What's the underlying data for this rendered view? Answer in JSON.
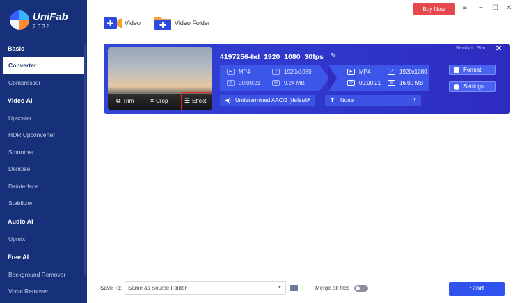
{
  "app": {
    "name": "UniFab",
    "version": "2.0.3.8"
  },
  "topbar": {
    "buy_now": "Buy Now",
    "menu_icon": "≡",
    "minimize_icon": "−",
    "maximize_icon": "☐",
    "close_icon": "✕"
  },
  "sidebar": {
    "sections": [
      {
        "title": "Basic",
        "items": [
          "Converter",
          "Compressor"
        ]
      },
      {
        "title": "Video AI",
        "items": [
          "Upscaler",
          "HDR Upconverter",
          "Smoother",
          "Denoise",
          "Deinterlace",
          "Stabilizer"
        ]
      },
      {
        "title": "Audio AI",
        "items": [
          "Upmix"
        ]
      },
      {
        "title": "Free AI",
        "items": [
          "Background Remover",
          "Vocal Remover"
        ]
      }
    ],
    "active": "Converter"
  },
  "toolbar": {
    "add_video": "Video",
    "add_folder": "Video Folder"
  },
  "task": {
    "status": "Ready to Start",
    "filename": "4197256-hd_1920_1080_30fps",
    "tools": {
      "trim": "Trim",
      "crop": "Crop",
      "effect": "Effect"
    },
    "source": {
      "format": "MP4",
      "resolution": "1920x1080",
      "duration": "00:00:21",
      "size": "9.24 MB"
    },
    "output": {
      "format": "MP4",
      "resolution": "1920x1080",
      "duration": "00:00:21",
      "size": "16.00 MB"
    },
    "audio_track": "Undetermined AAC/2 (default",
    "subtitle": "None",
    "format_button": "Format",
    "settings_button": "Settings"
  },
  "bottom": {
    "save_to_label": "Save To:",
    "save_to_value": "Same as Source Folder",
    "merge_label": "Merge all files",
    "merge_enabled": false,
    "start_button": "Start"
  },
  "colors": {
    "sidebar_bg": "#16307a",
    "card_bg": "#3244d9",
    "accent": "#3052ee",
    "buy_now": "#e5484d",
    "highlight_border": "#e0281f"
  }
}
